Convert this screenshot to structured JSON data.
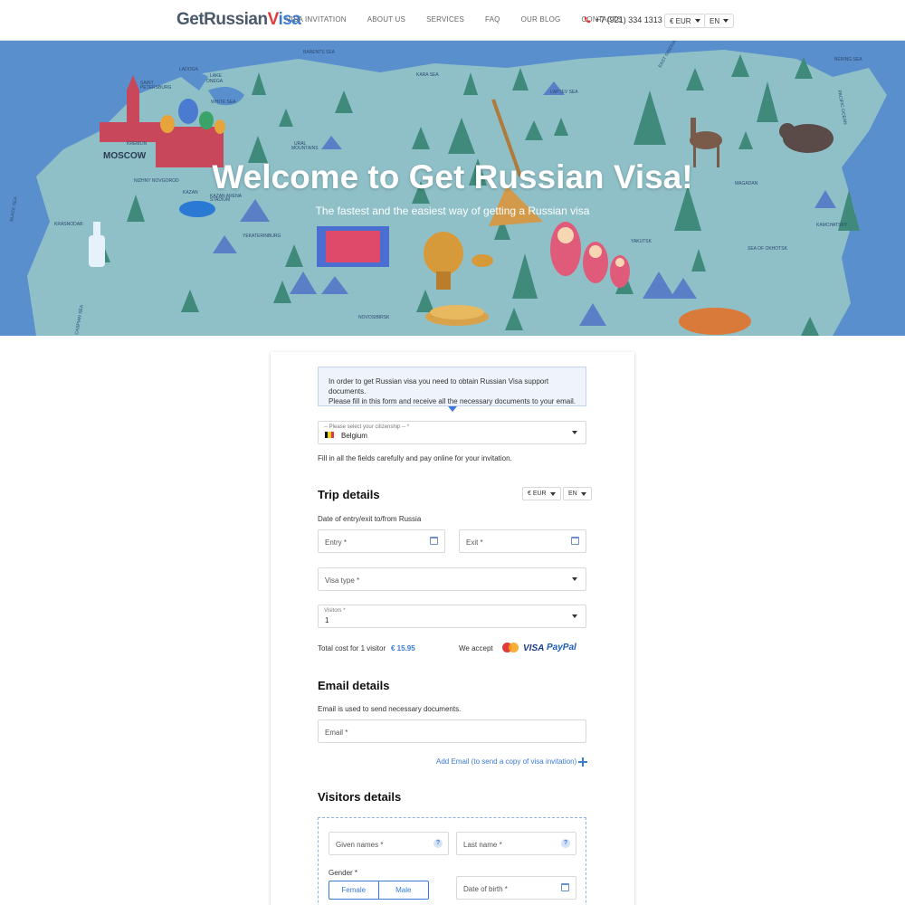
{
  "header": {
    "logo": {
      "part1": "GetRussian",
      "part2": "V",
      "part3": "isa"
    },
    "nav": [
      "VISA INVITATION",
      "ABOUT US",
      "SERVICES",
      "FAQ",
      "OUR BLOG",
      "CONTACTS"
    ],
    "phone": "+7 (921) 334 1313",
    "currency": "€ EUR",
    "language": "EN"
  },
  "hero": {
    "title": "Welcome to Get Russian Visa!",
    "subtitle": "The fastest and the easiest way of getting a Russian visa",
    "map_labels": [
      "MOSCOW",
      "SAINT PETERSBURG",
      "LADOGA",
      "LAKE ONEGA",
      "NIZHNY NOVGOROD",
      "KAZAN",
      "KAZAN ARENA STADIUM",
      "YEKATERINBURG",
      "NOVOSIBIRSK",
      "KRASNODAR",
      "BLACK SEA",
      "BARENTS SEA",
      "KARA SEA",
      "LAPTEV SEA",
      "EAST SIBERIAN SEA",
      "BERING SEA",
      "PACIFIC OCEAN",
      "MAGADAN",
      "KAMCHATSKY",
      "SEA OF OKHOTSK",
      "YAKUTSK",
      "KREMLIN",
      "WHITE SEA",
      "URAL MOUNTAINS",
      "CASPIAN SEA"
    ]
  },
  "form": {
    "info_text_line1": "In order to get Russian visa you need to obtain Russian Visa support documents.",
    "info_text_line2": "Please fill in this form and receive all the necessary documents to your email.",
    "citizenship_label": "-- Please select your citizenship -- *",
    "citizenship_value": "Belgium",
    "fill_note": "Fill in all the fields carefully and pay online for your invitation.",
    "trip_title": "Trip details",
    "trip_currency": "€ EUR",
    "trip_language": "EN",
    "dates_label": "Date of entry/exit to/from Russia",
    "entry_placeholder": "Entry *",
    "exit_placeholder": "Exit *",
    "visa_type_placeholder": "Visa type *",
    "visitors_label": "Visitors *",
    "visitors_value": "1",
    "total_label": "Total cost for 1 visitor",
    "total_value": "€ 15.95",
    "we_accept": "We accept",
    "visa_logo": "VISA",
    "paypal_logo": "PayPal",
    "email_title": "Email details",
    "email_note": "Email is used to send necessary documents.",
    "email_placeholder": "Email *",
    "add_email": "Add Email (to send a copy of visa invitation)",
    "visitors_title": "Visitors details",
    "given_names": "Given names *",
    "last_name": "Last name *",
    "help_mark": "?",
    "gender_label": "Gender *",
    "gender_female": "Female",
    "gender_male": "Male",
    "dob_placeholder": "Date of birth *"
  },
  "colors": {
    "accent": "#3a7bd5",
    "map_sea": "#5a8fcd",
    "map_land": "#8fc0c8",
    "danger": "#e23b3b"
  }
}
